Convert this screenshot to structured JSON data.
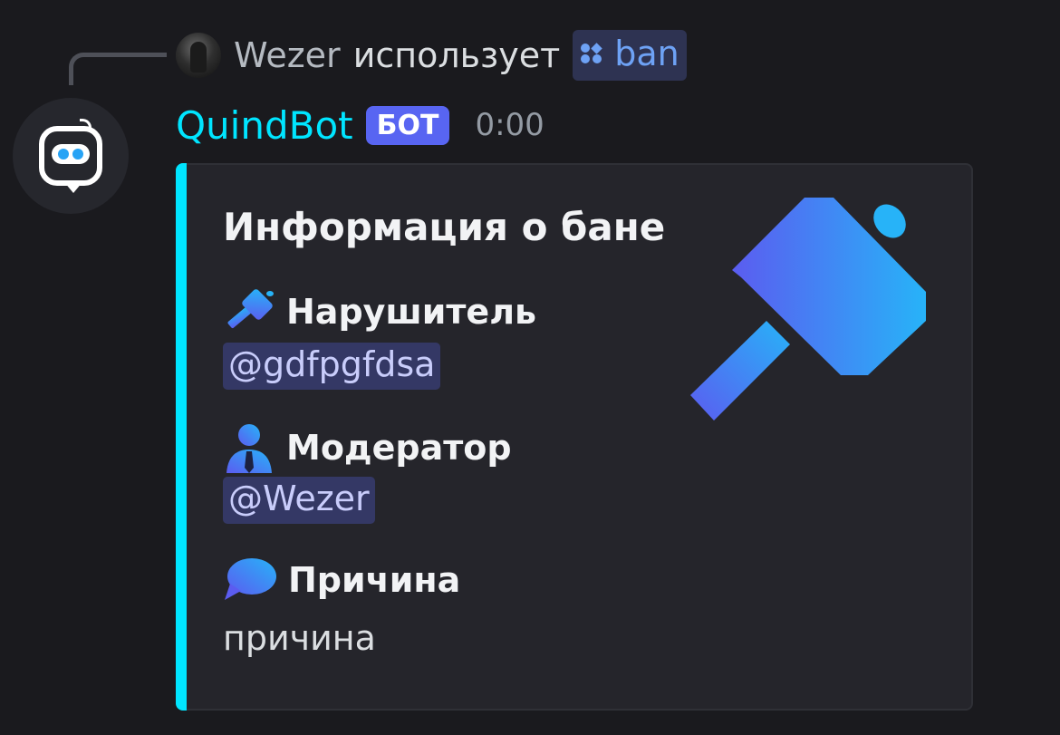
{
  "reply": {
    "user": "Wezer",
    "verb": "использует",
    "command": "ban"
  },
  "message": {
    "author": "QuindBot",
    "badge": "БОТ",
    "timestamp": "0:00"
  },
  "embed": {
    "accent_color": "#00e5ff",
    "title": "Информация о бане",
    "thumbnail_icon": "hammer-icon",
    "fields": [
      {
        "icon": "hammer-icon",
        "name": "Нарушитель",
        "value": "@gdfpgfdsa",
        "is_mention": true
      },
      {
        "icon": "moderator-icon",
        "name": "Модератор",
        "value": "@Wezer",
        "is_mention": true
      },
      {
        "icon": "speech-bubble-icon",
        "name": "Причина",
        "value": "причина",
        "is_mention": false
      }
    ]
  }
}
